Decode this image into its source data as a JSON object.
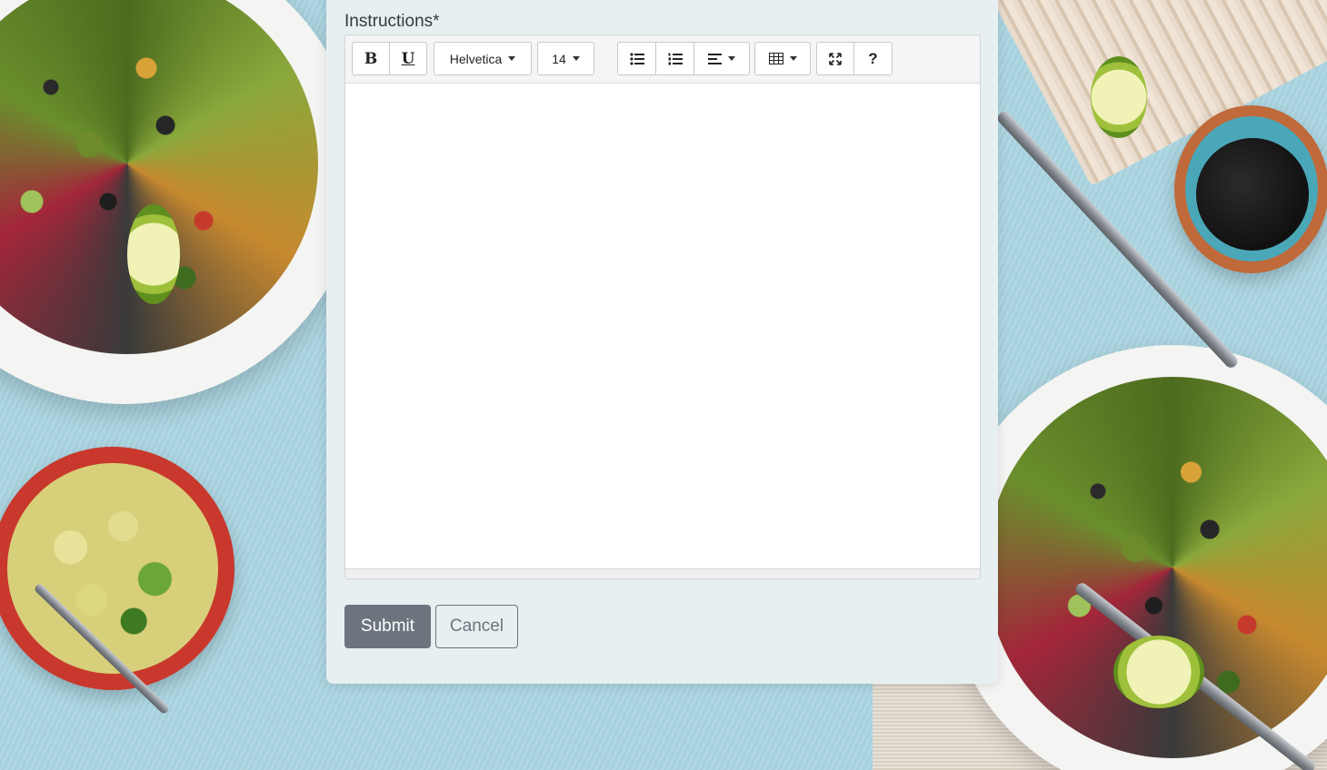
{
  "form": {
    "instructions_label": "Instructions*",
    "submit_label": "Submit",
    "cancel_label": "Cancel",
    "instructions_value": ""
  },
  "toolbar": {
    "bold_label": "B",
    "underline_label": "U",
    "font_family": "Helvetica",
    "font_size": "14",
    "help_label": "?",
    "icons": {
      "unordered_list": "unordered-list-icon",
      "ordered_list": "ordered-list-icon",
      "paragraph_align": "align-left-icon",
      "table": "table-icon",
      "fullscreen": "fullscreen-icon"
    }
  },
  "colors": {
    "card_background": "#e8eff1",
    "submit_background": "#6c757d",
    "cancel_border": "#6c757d",
    "label_text": "#33393f"
  }
}
